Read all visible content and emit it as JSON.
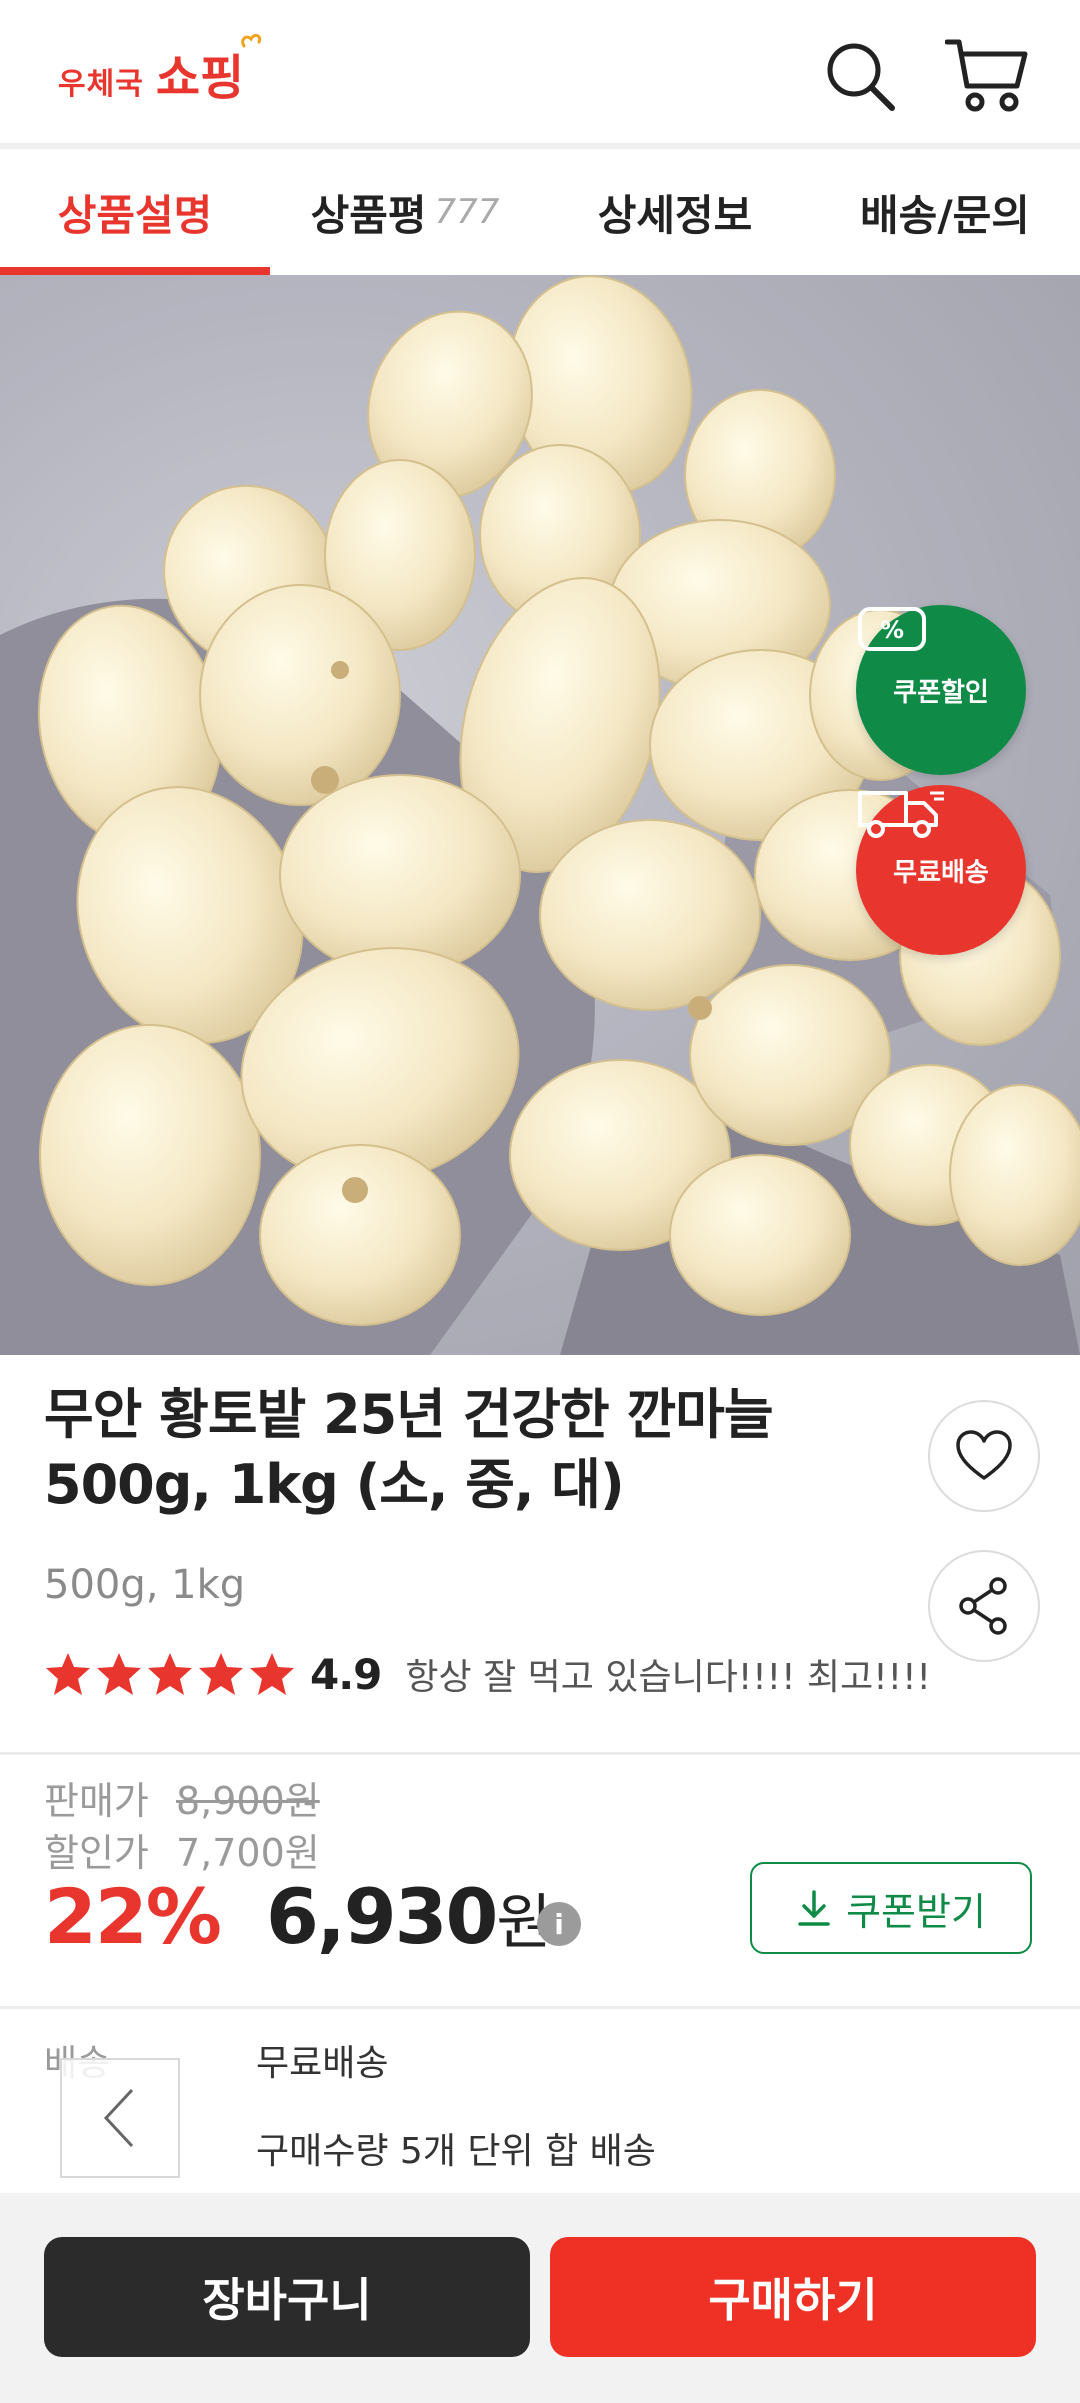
{
  "header": {
    "logo_small": "우체국",
    "logo_big": "쇼핑"
  },
  "tabs": [
    {
      "label": "상품설명",
      "count": ""
    },
    {
      "label": "상품평",
      "count": "777"
    },
    {
      "label": "상세정보",
      "count": ""
    },
    {
      "label": "배송/문의",
      "count": ""
    }
  ],
  "badges": {
    "coupon_symbol": "%",
    "coupon_label": "쿠폰할인",
    "ship_label": "무료배송"
  },
  "product": {
    "title": "무안 황토밭 25년 건강한 깐마늘 500g, 1kg (소, 중, 대)",
    "option": "500g, 1kg",
    "rating": 4.9,
    "rating_text": "4.9",
    "review_snippet": "항상 잘 먹고 있습니다!!!! 최고!!!!"
  },
  "price": {
    "sale_label": "판매가",
    "sale_value": "8,900원",
    "discount_label": "할인가",
    "discount_value": "7,700원",
    "discount_rate": "22%",
    "final_number": "6,930",
    "final_unit": "원",
    "info_symbol": "i",
    "coupon_button": "쿠폰받기"
  },
  "shipping": {
    "label": "배송",
    "free": "무료배송",
    "bundle": "구매수량 5개 단위 합 배송"
  },
  "bottom": {
    "cart_button": "장바구니",
    "buy_button": "구매하기"
  },
  "colors": {
    "brand_red": "#e8352d",
    "coupon_green": "#0f8a47",
    "buy_red": "#ee3124",
    "cart_dark": "#2b2b2b"
  },
  "icons": [
    "search-icon",
    "cart-icon",
    "heart-icon",
    "share-icon",
    "download-icon",
    "info-icon",
    "chevron-left-icon",
    "coupon-icon",
    "truck-icon"
  ],
  "carousel": {
    "pages": 2,
    "current": 1
  }
}
